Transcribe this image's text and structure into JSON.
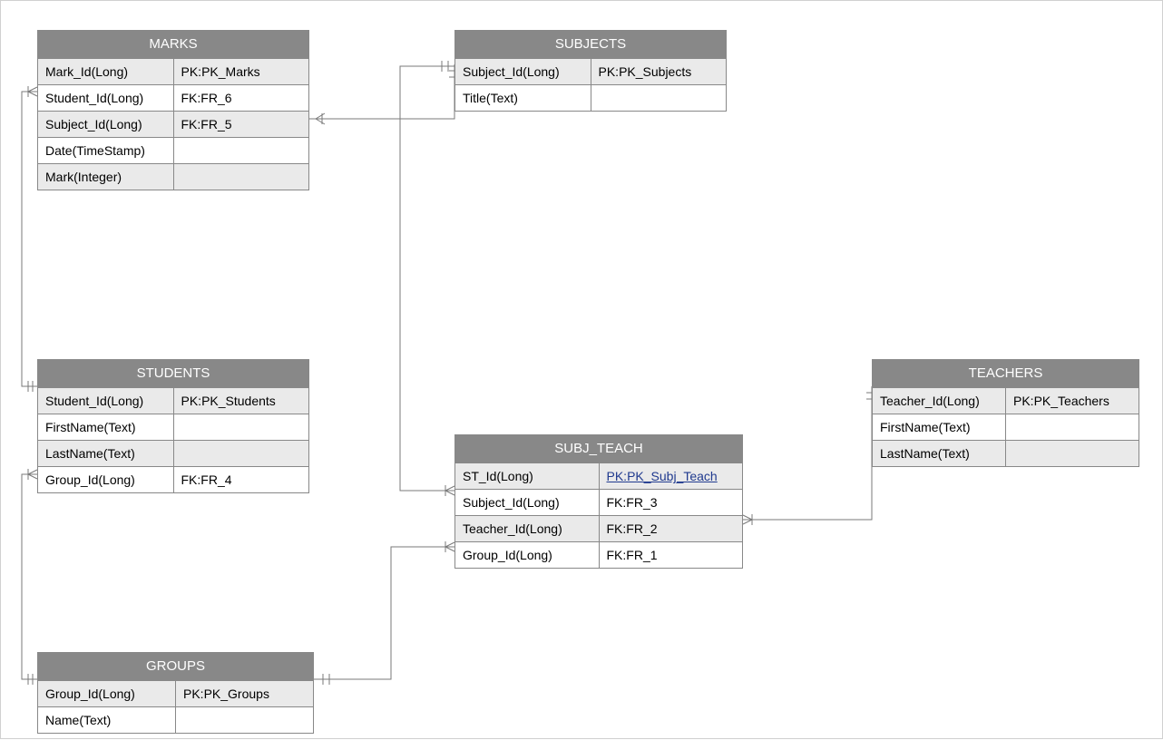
{
  "entities": {
    "marks": {
      "title": "MARKS",
      "rows": [
        {
          "name": "Mark_Id(Long)",
          "key": "PK:PK_Marks",
          "shade": true
        },
        {
          "name": "Student_Id(Long)",
          "key": "FK:FR_6",
          "shade": false
        },
        {
          "name": "Subject_Id(Long)",
          "key": "FK:FR_5",
          "shade": true
        },
        {
          "name": "Date(TimeStamp)",
          "key": "",
          "shade": false
        },
        {
          "name": "Mark(Integer)",
          "key": "",
          "shade": true
        }
      ]
    },
    "subjects": {
      "title": "SUBJECTS",
      "rows": [
        {
          "name": "Subject_Id(Long)",
          "key": "PK:PK_Subjects",
          "shade": true
        },
        {
          "name": "Title(Text)",
          "key": "",
          "shade": false
        }
      ]
    },
    "students": {
      "title": "STUDENTS",
      "rows": [
        {
          "name": "Student_Id(Long)",
          "key": "PK:PK_Students",
          "shade": true
        },
        {
          "name": "FirstName(Text)",
          "key": "",
          "shade": false
        },
        {
          "name": "LastName(Text)",
          "key": "",
          "shade": true
        },
        {
          "name": "Group_Id(Long)",
          "key": "FK:FR_4",
          "shade": false
        }
      ]
    },
    "subj_teach": {
      "title": "SUBJ_TEACH",
      "rows": [
        {
          "name": "ST_Id(Long)",
          "key": "PK:PK_Subj_Teach",
          "shade": true,
          "pk_link": true
        },
        {
          "name": "Subject_Id(Long)",
          "key": "FK:FR_3",
          "shade": false
        },
        {
          "name": "Teacher_Id(Long)",
          "key": "FK:FR_2",
          "shade": true
        },
        {
          "name": "Group_Id(Long)",
          "key": "FK:FR_1",
          "shade": false
        }
      ]
    },
    "teachers": {
      "title": "TEACHERS",
      "rows": [
        {
          "name": "Teacher_Id(Long)",
          "key": "PK:PK_Teachers",
          "shade": true
        },
        {
          "name": "FirstName(Text)",
          "key": "",
          "shade": false
        },
        {
          "name": "LastName(Text)",
          "key": "",
          "shade": true
        }
      ]
    },
    "groups": {
      "title": "GROUPS",
      "rows": [
        {
          "name": "Group_Id(Long)",
          "key": "PK:PK_Groups",
          "shade": true
        },
        {
          "name": "Name(Text)",
          "key": "",
          "shade": false
        }
      ]
    }
  },
  "relationships": [
    {
      "from": "MARKS.Subject_Id",
      "to": "SUBJECTS.Subject_Id",
      "fk": "FR_5"
    },
    {
      "from": "MARKS.Student_Id",
      "to": "STUDENTS.Student_Id",
      "fk": "FR_6"
    },
    {
      "from": "STUDENTS.Group_Id",
      "to": "GROUPS.Group_Id",
      "fk": "FR_4"
    },
    {
      "from": "SUBJ_TEACH.Subject_Id",
      "to": "SUBJECTS.Subject_Id",
      "fk": "FR_3"
    },
    {
      "from": "SUBJ_TEACH.Teacher_Id",
      "to": "TEACHERS.Teacher_Id",
      "fk": "FR_2"
    },
    {
      "from": "SUBJ_TEACH.Group_Id",
      "to": "GROUPS.Group_Id",
      "fk": "FR_1"
    }
  ]
}
